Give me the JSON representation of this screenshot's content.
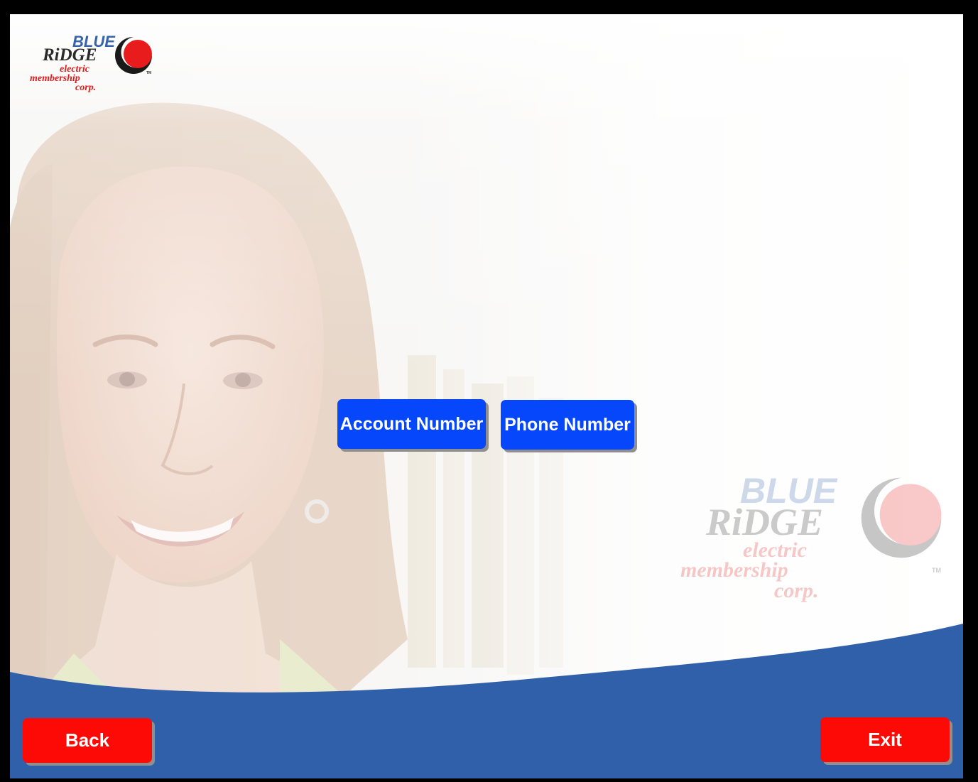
{
  "brand": {
    "line1": "BLUE",
    "line2": "RiDGE",
    "line3": "electric",
    "line4": "membership",
    "line5": "corp.",
    "trademark": "TM",
    "colors": {
      "blue": "#3563ad",
      "red": "#e01b1b",
      "gray": "#2b2b2b"
    }
  },
  "options": {
    "account_number_label": "Account Number",
    "phone_number_label": "Phone Number"
  },
  "footer": {
    "back_label": "Back",
    "exit_label": "Exit"
  },
  "colors": {
    "option_button": "#0647fb",
    "nav_button": "#fd0a07",
    "footer_band": "#3060aa"
  }
}
